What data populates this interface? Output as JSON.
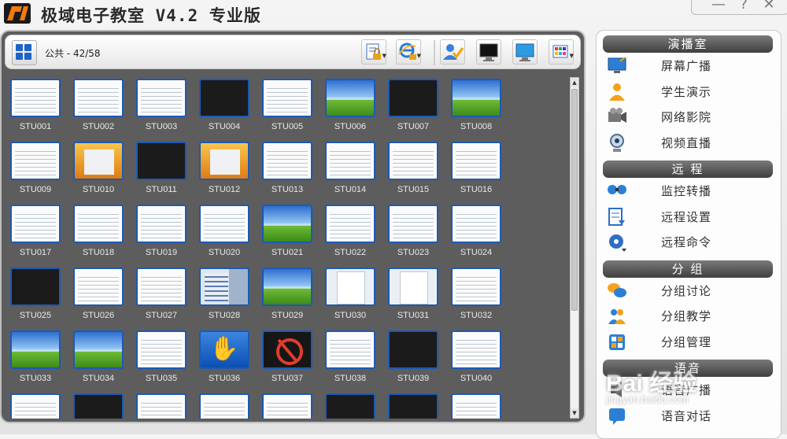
{
  "window": {
    "title": "极域电子教室 V4.2 专业版",
    "controls": {
      "minimize": "—",
      "help": "?",
      "close": "✕"
    }
  },
  "toolbar": {
    "group_label": "公共 - 42/58",
    "buttons": [
      {
        "name": "lock-screen-button",
        "icon": "document-lock-icon",
        "has_dropdown": true
      },
      {
        "name": "network-lock-button",
        "icon": "ie-lock-icon",
        "has_dropdown": true
      },
      {
        "name": "signin-button",
        "icon": "user-check-icon",
        "has_dropdown": false
      },
      {
        "name": "black-screen-button",
        "icon": "monitor-black-icon",
        "has_dropdown": false
      },
      {
        "name": "monitor-button",
        "icon": "monitor-blue-icon",
        "has_dropdown": false
      },
      {
        "name": "layout-button",
        "icon": "grid-layout-icon",
        "has_dropdown": true
      }
    ]
  },
  "students": [
    {
      "label": "STU001",
      "thumb": "doc"
    },
    {
      "label": "STU002",
      "thumb": "doc"
    },
    {
      "label": "STU003",
      "thumb": "doc"
    },
    {
      "label": "STU004",
      "thumb": "black"
    },
    {
      "label": "STU005",
      "thumb": "doc"
    },
    {
      "label": "STU006",
      "thumb": "xp"
    },
    {
      "label": "STU007",
      "thumb": "black"
    },
    {
      "label": "STU008",
      "thumb": "xp"
    },
    {
      "label": "STU009",
      "thumb": "doc"
    },
    {
      "label": "STU010",
      "thumb": "orange"
    },
    {
      "label": "STU011",
      "thumb": "black"
    },
    {
      "label": "STU012",
      "thumb": "orange"
    },
    {
      "label": "STU013",
      "thumb": "doc"
    },
    {
      "label": "STU014",
      "thumb": "doc"
    },
    {
      "label": "STU015",
      "thumb": "doc"
    },
    {
      "label": "STU016",
      "thumb": "doc"
    },
    {
      "label": "STU017",
      "thumb": "doc"
    },
    {
      "label": "STU018",
      "thumb": "doc"
    },
    {
      "label": "STU019",
      "thumb": "doc"
    },
    {
      "label": "STU020",
      "thumb": "doc"
    },
    {
      "label": "STU021",
      "thumb": "xp"
    },
    {
      "label": "STU022",
      "thumb": "doc"
    },
    {
      "label": "STU023",
      "thumb": "doc"
    },
    {
      "label": "STU024",
      "thumb": "doc"
    },
    {
      "label": "STU025",
      "thumb": "black"
    },
    {
      "label": "STU026",
      "thumb": "doc"
    },
    {
      "label": "STU027",
      "thumb": "doc"
    },
    {
      "label": "STU028",
      "thumb": "desk"
    },
    {
      "label": "STU029",
      "thumb": "xp"
    },
    {
      "label": "STU030",
      "thumb": "paper"
    },
    {
      "label": "STU031",
      "thumb": "paper"
    },
    {
      "label": "STU032",
      "thumb": "doc"
    },
    {
      "label": "STU033",
      "thumb": "xp"
    },
    {
      "label": "STU034",
      "thumb": "xp"
    },
    {
      "label": "STU035",
      "thumb": "doc"
    },
    {
      "label": "STU036",
      "thumb": "hand"
    },
    {
      "label": "STU037",
      "thumb": "lock"
    },
    {
      "label": "STU038",
      "thumb": "doc"
    },
    {
      "label": "STU039",
      "thumb": "black"
    },
    {
      "label": "STU040",
      "thumb": "doc"
    },
    {
      "label": "",
      "thumb": "doc"
    },
    {
      "label": "",
      "thumb": "black"
    },
    {
      "label": "",
      "thumb": "doc"
    },
    {
      "label": "",
      "thumb": "doc"
    },
    {
      "label": "",
      "thumb": "doc"
    },
    {
      "label": "",
      "thumb": "black"
    },
    {
      "label": "",
      "thumb": "black"
    },
    {
      "label": "",
      "thumb": "doc"
    }
  ],
  "side_panel": {
    "sections": [
      {
        "title": "演播室",
        "items": [
          {
            "label": "屏幕广播",
            "icon": "screen-broadcast-icon"
          },
          {
            "label": "学生演示",
            "icon": "student-demo-icon"
          },
          {
            "label": "网络影院",
            "icon": "network-cinema-icon"
          },
          {
            "label": "视频直播",
            "icon": "webcam-icon"
          }
        ]
      },
      {
        "title": "远 程",
        "items": [
          {
            "label": "监控转播",
            "icon": "monitor-relay-icon"
          },
          {
            "label": "远程设置",
            "icon": "remote-settings-icon"
          },
          {
            "label": "远程命令",
            "icon": "gear-icon"
          }
        ]
      },
      {
        "title": "分 组",
        "items": [
          {
            "label": "分组讨论",
            "icon": "chat-bubbles-icon"
          },
          {
            "label": "分组教学",
            "icon": "group-teaching-icon"
          },
          {
            "label": "分组管理",
            "icon": "group-manage-icon"
          }
        ]
      },
      {
        "title": "语音",
        "items": [
          {
            "label": "语音广播",
            "icon": "voice-broadcast-icon"
          },
          {
            "label": "语音对话",
            "icon": "voice-chat-icon"
          }
        ]
      }
    ]
  },
  "watermark": {
    "text": "Bai 经验",
    "url": "jingyan.baidu.com"
  },
  "colors": {
    "panel_dark": "#5d5d5d",
    "thumb_border": "#1d59b3",
    "accent_blue": "#1e64c8"
  }
}
